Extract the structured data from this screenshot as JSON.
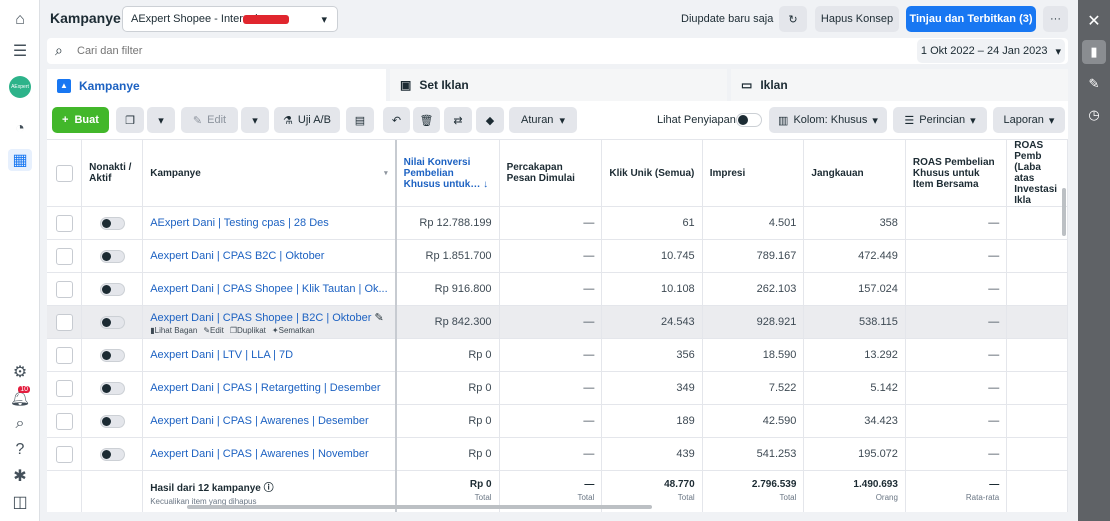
{
  "left_nav": {
    "icons": [
      "home-icon",
      "menu-icon",
      "account-avatar",
      "gauge-icon",
      "table-grid-icon",
      "settings-icon",
      "notification-bell-icon",
      "search-icon",
      "help-icon",
      "bug-icon",
      "panel-icon"
    ],
    "avatar_text": "AExpert",
    "notification_count": "10"
  },
  "header": {
    "title": "Kampanye",
    "account_name": "AExpert Shopee - Internal",
    "updated_text": "Diupdate baru saja",
    "discard_label": "Hapus Konsep",
    "publish_label": "Tinjau dan Terbitkan (3)",
    "more_label": "···"
  },
  "search": {
    "placeholder": "Cari dan filter",
    "date_range": "1 Okt 2022 – 24 Jan 2023"
  },
  "tabs": [
    {
      "label": "Kampanye"
    },
    {
      "label": "Set Iklan"
    },
    {
      "label": "Iklan"
    }
  ],
  "toolbar": {
    "create_label": "Buat",
    "edit_label": "Edit",
    "ab_label": "Uji A/B",
    "rules_label": "Aturan",
    "preview_label": "Lihat Penyiapan",
    "columns_label": "Kolom: Khusus",
    "breakdown_label": "Perincian",
    "reports_label": "Laporan"
  },
  "columns": [
    "Nonakti / Aktif",
    "Kampanye",
    "Nilai Konversi Pembelian Khusus untuk…",
    "Percakapan Pesan Dimulai",
    "Klik Unik (Semua)",
    "Impresi",
    "Jangkauan",
    "ROAS Pembelian Khusus untuk Item Bersama",
    "ROAS Pemb (Laba atas Investasi Ikla"
  ],
  "row_actions": {
    "view": "Lihat Bagan",
    "edit": "Edit",
    "duplicate": "Duplikat",
    "pin": "Sematkan"
  },
  "rows": [
    {
      "name": "AExpert Dani | Testing cpas | 28 Des",
      "value": "Rp 12.788.199",
      "conv": "—",
      "clicks": "61",
      "impressions": "4.501",
      "reach": "358",
      "roas": "—"
    },
    {
      "name": "Aexpert Dani | CPAS B2C | Oktober",
      "value": "Rp 1.851.700",
      "conv": "—",
      "clicks": "10.745",
      "impressions": "789.167",
      "reach": "472.449",
      "roas": "—"
    },
    {
      "name": "Aexpert Dani | CPAS Shopee | Klik Tautan | Ok...",
      "value": "Rp 916.800",
      "conv": "—",
      "clicks": "10.108",
      "impressions": "262.103",
      "reach": "157.024",
      "roas": "—"
    },
    {
      "name": "Aexpert Dani | CPAS Shopee | B2C | Oktober",
      "value": "Rp 842.300",
      "conv": "—",
      "clicks": "24.543",
      "impressions": "928.921",
      "reach": "538.115",
      "roas": "—"
    },
    {
      "name": "Aexpert Dani | LTV | LLA | 7D",
      "value": "Rp 0",
      "conv": "—",
      "clicks": "356",
      "impressions": "18.590",
      "reach": "13.292",
      "roas": "—"
    },
    {
      "name": "Aexpert Dani | CPAS | Retargetting | Desember",
      "value": "Rp 0",
      "conv": "—",
      "clicks": "349",
      "impressions": "7.522",
      "reach": "5.142",
      "roas": "—"
    },
    {
      "name": "Aexpert Dani | CPAS | Awarenes | Desember",
      "value": "Rp 0",
      "conv": "—",
      "clicks": "189",
      "impressions": "42.590",
      "reach": "34.423",
      "roas": "—"
    },
    {
      "name": "Aexpert Dani | CPAS | Awarenes | November",
      "value": "Rp 0",
      "conv": "—",
      "clicks": "439",
      "impressions": "541.253",
      "reach": "195.072",
      "roas": "—"
    }
  ],
  "footer": {
    "title": "Hasil dari 12 kampanye",
    "subtitle": "Kecualikan item yang dihapus",
    "value": "Rp 0",
    "value_lbl": "Total",
    "conv": "—",
    "conv_lbl": "Total",
    "clicks": "48.770",
    "clicks_lbl": "Total",
    "impressions": "2.796.539",
    "impressions_lbl": "Total",
    "reach": "1.490.693",
    "reach_lbl": "Orang",
    "roas": "—",
    "roas_lbl": "Rata-rata"
  }
}
